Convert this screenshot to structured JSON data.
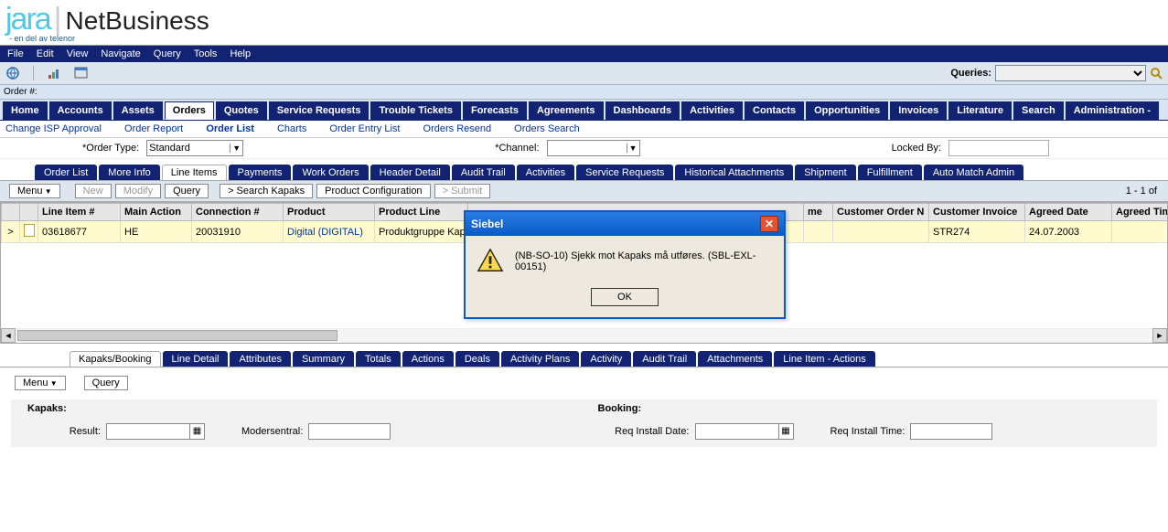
{
  "brand": {
    "logo": "jara",
    "sub": "- en del av telenor",
    "app": "NetBusiness"
  },
  "menubar": [
    "File",
    "Edit",
    "View",
    "Navigate",
    "Query",
    "Tools",
    "Help"
  ],
  "toolbar": {
    "queries_label": "Queries:"
  },
  "orderbar": {
    "label": "Order #:"
  },
  "ptabs": {
    "items": [
      "Home",
      "Accounts",
      "Assets",
      "Orders",
      "Quotes",
      "Service Requests",
      "Trouble Tickets",
      "Forecasts",
      "Agreements",
      "Dashboards",
      "Activities",
      "Contacts",
      "Opportunities",
      "Invoices",
      "Literature",
      "Search",
      "Administration -"
    ],
    "active": "Orders"
  },
  "sublinks": {
    "items": [
      "Change ISP Approval",
      "Order Report",
      "Order List",
      "Charts",
      "Order Entry List",
      "Orders Resend",
      "Orders Search"
    ],
    "active": "Order List"
  },
  "orderform": {
    "type_label": "*Order Type:",
    "type_value": "Standard",
    "channel_label": "*Channel:",
    "locked_label": "Locked By:"
  },
  "stabs": {
    "items": [
      "Order List",
      "More Info",
      "Line Items",
      "Payments",
      "Work Orders",
      "Header Detail",
      "Audit Trail",
      "Activities",
      "Service Requests",
      "Historical Attachments",
      "Shipment",
      "Fulfillment",
      "Auto Match Admin"
    ],
    "active": "Line Items"
  },
  "gridbar": {
    "menu": "Menu",
    "new": "New",
    "modify": "Modify",
    "query": "Query",
    "search_kapaks": "> Search Kapaks",
    "prod_config": "Product Configuration",
    "submit": "> Submit",
    "pager": "1 - 1 of"
  },
  "grid": {
    "headers": [
      "",
      "",
      "Line Item #",
      "Main Action",
      "Connection #",
      "Product",
      "Product Line",
      "",
      "me",
      "Customer Order N",
      "Customer Invoice",
      "Agreed Date",
      "Agreed Time"
    ],
    "widths": [
      20,
      20,
      90,
      78,
      100,
      100,
      102,
      367,
      32,
      105,
      105,
      95,
      100
    ],
    "rows": [
      {
        "ind": ">",
        "line_item": "03618677",
        "main_action": "HE",
        "connection": "20031910",
        "product": "Digital (DIGITAL)",
        "product_line": "Produktgruppe Kapa",
        "cust_order": "",
        "cust_invoice": "STR274",
        "agreed_date": "24.07.2003",
        "agreed_time": ""
      }
    ]
  },
  "ltabs": {
    "items": [
      "Kapaks/Booking",
      "Line Detail",
      "Attributes",
      "Summary",
      "Totals",
      "Actions",
      "Deals",
      "Activity Plans",
      "Activity",
      "Audit Trail",
      "Attachments",
      "Line Item - Actions"
    ],
    "active": "Kapaks/Booking"
  },
  "lowerbar": {
    "menu": "Menu",
    "query": "Query"
  },
  "kapaks": {
    "title": "Kapaks:",
    "result_label": "Result:",
    "modersentral_label": "Modersentral:"
  },
  "booking": {
    "title": "Booking:",
    "req_date_label": "Req Install Date:",
    "req_time_label": "Req Install Time:"
  },
  "modal": {
    "title": "Siebel",
    "message": "(NB-SO-10)  Sjekk mot Kapaks må utføres. (SBL-EXL-00151)",
    "ok": "OK"
  }
}
